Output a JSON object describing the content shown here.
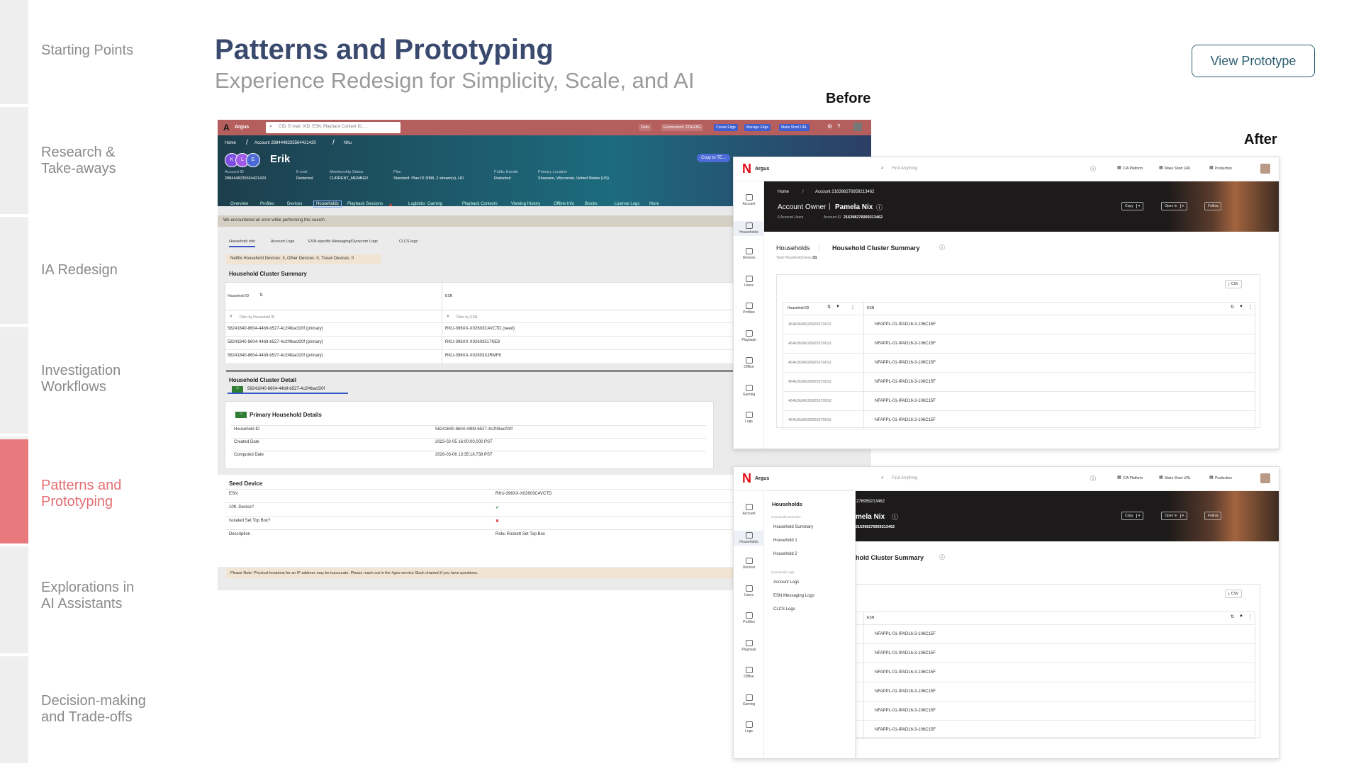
{
  "nav": {
    "items": [
      {
        "label": "Starting Points",
        "active": false
      },
      {
        "label": "Research &\nTake-aways",
        "active": false
      },
      {
        "label": "IA Redesign",
        "active": false
      },
      {
        "label": "Investigation\nWorkflows",
        "active": false
      },
      {
        "label": "Patterns and\nPrototyping",
        "active": true
      },
      {
        "label": "Explorations in\nAI Assistants",
        "active": false
      },
      {
        "label": "Decision-making\nand Trade-offs",
        "active": false
      }
    ]
  },
  "header": {
    "title": "Patterns and Prototyping",
    "subtitle": "Experience Redesign for Simplicity, Scale, and AI",
    "view_button": "View Prototype",
    "before_label": "Before",
    "after_label": "After"
  },
  "before": {
    "brand": "Argus",
    "search_placeholder": "CID, E-mail, XID, ESN, Playback Context ID, ...",
    "top_buttons": [
      "Tools",
      "Environment: STAGING",
      "Create Edge",
      "Manage Edge",
      "Make Short URL"
    ],
    "breadcrumb": [
      "Home",
      "Account 2884448235564421420",
      "Nhu"
    ],
    "avatars": [
      "K",
      "L",
      "E"
    ],
    "user_name": "Erik",
    "copy_button": "Copy to TE...",
    "fields": [
      {
        "label": "Account ID",
        "value": "2884448235564421420"
      },
      {
        "label": "E-mail",
        "value": "Redacted"
      },
      {
        "label": "Membership Status",
        "value": "CURRENT_MEMBER"
      },
      {
        "label": "Plan",
        "value": "Standard: Plan ID 3088, 2 stream(s), HD"
      },
      {
        "label": "Public Handle",
        "value": "Redacted"
      },
      {
        "label": "Primary Location",
        "value": "Shawano, Wisconsin, United States (US)"
      }
    ],
    "tabs": [
      "Overview",
      "Profiles",
      "Devices",
      "Households",
      "Playback Sessions",
      "Logbinks",
      "Gaming",
      "Playback Contexts",
      "Viewing History",
      "Offline Info",
      "Blocks",
      "License Logs",
      "More"
    ],
    "error": "We encountered an error while performing this search",
    "subtabs": [
      "Household Info",
      "Account Logs",
      "ESN-specific Messaging/Dynecom Logs",
      "CLCS logs"
    ],
    "device_summary": "Netflix Household Devices: 3, Other Devices: 0, Travel Devices: 0",
    "cluster_title": "Household Cluster Summary",
    "cluster_cols": [
      "Household ID",
      "ESN"
    ],
    "cluster_filters": [
      "Filter by Household ID",
      "Filter by ESN"
    ],
    "cluster_rows": [
      [
        "58241840-8604-44b9-b527-4c2f4bacf20f (primary)",
        "RKU-396XX-X02603C4VCTD (seed)"
      ],
      [
        "58241840-8604-44b9-b527-4c2f4bacf20f (primary)",
        "RKU-396XX-X02603517NE8"
      ],
      [
        "58241840-8604-44b9-b527-4c2f4bacf20f (primary)",
        "RKU-396XX-X02603XJRMFK"
      ]
    ],
    "detail_title": "Household Cluster Detail",
    "detail_tab": "58241840-8604-44b9-b527-4c2f4bacf20f",
    "primary_title": "Primary Household Details",
    "primary_rows": [
      [
        "Household ID",
        "58241840-8604-44b9-b527-4c2f4bacf20f"
      ],
      [
        "Created Date",
        "2023-02-05 16:00:00,000 PST"
      ],
      [
        "Computed Date",
        "2026-03-06 13:35:18,738 PST"
      ]
    ],
    "seed_title": "Seed Device",
    "seed_rows": [
      [
        "ESN",
        "RKU-396XX-X02603C4VCTD"
      ],
      [
        "10ft. Device?",
        "✔"
      ],
      [
        "Isolated Set Top Box?",
        "✖"
      ],
      [
        "Description",
        "Roku Rockett Set Top Box"
      ]
    ],
    "note": "Please Note: Physical locations for an IP address may be inaccurate. Please reach out in the #geo-service Slack channel if you have questions."
  },
  "after": {
    "brand": "Argus",
    "search_placeholder": "Find Anything",
    "top_links": [
      "CIA Platform",
      "Make Short URL",
      "Production"
    ],
    "sidebar": [
      "Account",
      "Households",
      "Devices",
      "Users",
      "Profiles",
      "Playback",
      "Offline",
      "Gaming",
      "Logs"
    ],
    "breadcrumb": [
      "Home",
      "Account 2163982769592134​62"
    ],
    "owner_label": "Account Owner",
    "owner_name": "Pamela Nix",
    "account_users": "6 Account Users",
    "account_id_label": "Account ID",
    "account_id": "2163982769592134​62",
    "hero_buttons": [
      "Copy",
      "Open in",
      "Follow"
    ],
    "page_parent": "Households",
    "page_title": "Household Cluster Summary",
    "total_devices_label": "Total Household Devices:",
    "total_devices": "31",
    "csv_button": "CSV",
    "cols": [
      "Household ID",
      "ESN"
    ],
    "rows": [
      [
        "464k3h36626625370012",
        "NFAPPL-01-IPAD16-3-106C15F"
      ],
      [
        "464k3h36626625370012",
        "NFAPPL-01-IPAD16-3-106C15F"
      ],
      [
        "464k3h36626625370012",
        "NFAPPL-01-IPAD16-3-106C15F"
      ],
      [
        "464k3h36626625370012",
        "NFAPPL-01-IPAD16-3-106C15F"
      ],
      [
        "464k3h36626625370012",
        "NFAPPL-01-IPAD16-3-106C15F"
      ],
      [
        "464k3h36626625370012",
        "NFAPPL-01-IPAD16-3-106C15F"
      ]
    ],
    "flyout": {
      "title": "Households",
      "group1": "Household Overview",
      "items1": [
        "Household Summary",
        "Household 1",
        "Household 2"
      ],
      "group2": "Household Logs",
      "items2": [
        "Account Logs",
        "ESN Messaging Logs",
        "CLCS Logs"
      ]
    },
    "hero2_id": "2163982769592134​62",
    "hero2_name": "mela Nix",
    "hero2_id_partial": "276959213462",
    "title2_partial": "hold Cluster Summary"
  },
  "colors": {
    "accent": "#e8797c",
    "title": "#3a4a6e",
    "button": "#2f5f73"
  }
}
